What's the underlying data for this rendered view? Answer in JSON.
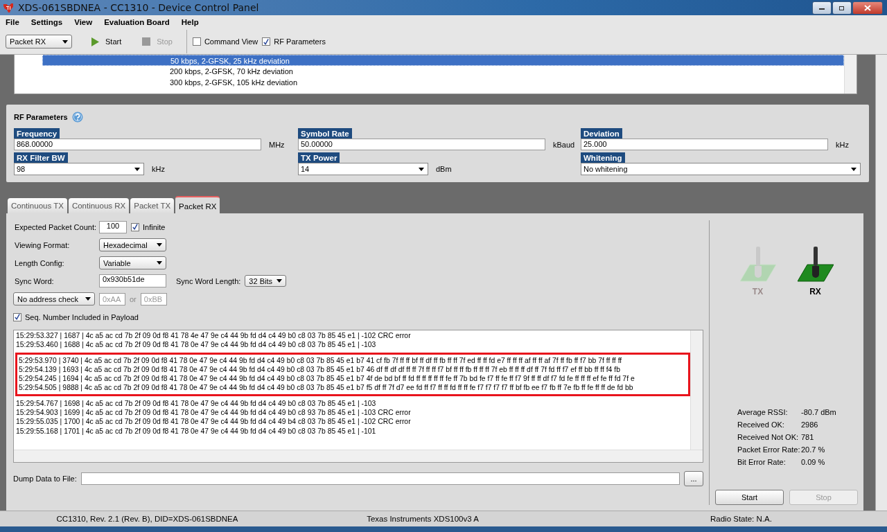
{
  "window": {
    "title": "XDS-061SBDNEA - CC1310 - Device Control Panel"
  },
  "menu": [
    {
      "label": "File"
    },
    {
      "label": "Settings"
    },
    {
      "label": "View"
    },
    {
      "label": "Evaluation Board"
    },
    {
      "label": "Help"
    }
  ],
  "toolbar": {
    "mode": "Packet RX",
    "start": {
      "label": "Start",
      "disabled": false
    },
    "stop": {
      "label": "Stop",
      "disabled": true
    },
    "checks": [
      {
        "label": "Command View",
        "checked": false
      },
      {
        "label": "RF Parameters",
        "checked": true
      }
    ]
  },
  "presets": [
    {
      "label": "50 kbps, 2-GFSK, 25 kHz deviation",
      "selected": true
    },
    {
      "label": "200 kbps, 2-GFSK, 70 kHz deviation",
      "selected": false
    },
    {
      "label": "300 kbps, 2-GFSK, 105 kHz deviation",
      "selected": false
    }
  ],
  "rf_parameters": {
    "title": "RF Parameters",
    "fields": [
      {
        "label": "Frequency",
        "kind": "input",
        "value": "868.00000",
        "unit": "MHz"
      },
      {
        "label": "Symbol Rate",
        "kind": "input",
        "value": "50.00000",
        "unit": "kBaud"
      },
      {
        "label": "Deviation",
        "kind": "input",
        "value": "25.000",
        "unit": "kHz"
      },
      {
        "label": "RX Filter BW",
        "kind": "select",
        "value": "98",
        "unit": "kHz"
      },
      {
        "label": "TX Power",
        "kind": "select",
        "value": "14",
        "unit": "dBm"
      },
      {
        "label": "Whitening",
        "kind": "select",
        "value": "No whitening"
      }
    ]
  },
  "tabs": [
    {
      "label": "Continuous TX",
      "selected": false
    },
    {
      "label": "Continuous RX",
      "selected": false
    },
    {
      "label": "Packet TX",
      "selected": false
    },
    {
      "label": "Packet RX",
      "selected": true
    }
  ],
  "packet_rx": {
    "expected_count": {
      "label": "Expected Packet Count:",
      "value": "100"
    },
    "infinite": {
      "label": "Infinite",
      "checked": true
    },
    "viewing_format": {
      "label": "Viewing Format:",
      "value": "Hexadecimal"
    },
    "length_config": {
      "label": "Length Config:",
      "value": "Variable"
    },
    "sync_word": {
      "label": "Sync Word:",
      "value": "0x930b51de"
    },
    "sync_word_length": {
      "label": "Sync Word Length:",
      "value": "32 Bits"
    },
    "address_check": {
      "value": "No address check"
    },
    "address_1": {
      "placeholder": "0xAA"
    },
    "or": "or",
    "address_2": {
      "placeholder": "0xBB"
    },
    "seq_number": {
      "label": "Seq. Number Included in Payload",
      "checked": true
    }
  },
  "log": {
    "rows": [
      {
        "text": "15:29:53.327 | 1687 | 4c a5 ac cd 7b 2f 09 0d f8 41 78 4e 47 9e c4 44 9b fd d4 c4 49 b0 c8 03 7b 85 45 e1  | -102 CRC error",
        "highlighted": false
      },
      {
        "text": "15:29:53.460 | 1688 | 4c a5 ac cd 7b 2f 09 0d f8 41 78 0e 47 9e c4 44 9b fd d4 c4 49 b0 c8 03 7b 85 45 e1  | -103",
        "highlighted": false
      },
      {
        "text": "5:29:53.970 | 3740 | 4c a5 ac cd 7b 2f 09 0d f8 41 78 0e 47 9e c4 44 9b fd d4 c4 49 b0 c8 03 7b 85 45 e1 b7 41 cf fb 7f ff ff bf ff df ff fb ff ff 7f ed ff ff fd e7 ff ff ff af ff ff af 7f ff fb ff f7 bb 7f ff ff ff",
        "highlighted": true
      },
      {
        "text": "5:29:54.139 | 1693 | 4c a5 ac cd 7b 2f 09 0d f8 41 78 0e 47 9e c4 44 9b fd d4 c4 49 b0 c8 03 7b 85 45 e1 b7 46 df ff df df ff ff 7f ff ff f7 bf ff ff fb ff ff ff 7f eb ff ff ff df ff 7f fd ff f7 ef ff bb ff ff f4 fb",
        "highlighted": true
      },
      {
        "text": "5:29:54.245 | 1694 | 4c a5 ac cd 7b 2f 09 0d f8 41 78 0e 47 9e c4 44 9b fd d4 c4 49 b0 c8 03 7b 85 45 e1 b7 4f de bd bf ff fd ff ff ff ff ff fe ff 7b bd fe f7 ff fe ff f7 9f ff ff df f7 fd fe ff ff ff ef fe ff fd 7f e",
        "highlighted": true
      },
      {
        "text": "5:29:54.505 | 9888 | 4c a5 ac cd 7b 2f 09 0d f8 41 78 0e 47 9e c4 44 9b fd d4 c4 49 b0 c8 03 7b 85 45 e1 b7 f5 df ff 7f d7 ee fd ff f7 ff ff fd ff ff fe f7 f7 f7 f7 ff bf fb ee f7 fb ff 7e fb ff fe ff ff de fd bb",
        "highlighted": true
      },
      {
        "text": "15:29:54.767 | 1698 | 4c a5 ac cd 7b 2f 09 0d f8 41 78 0e 47 9e c4 44 9b fd d4 c4 49 b0 c8 03 7b 85 45 e1  | -103",
        "highlighted": false
      },
      {
        "text": "15:29:54.903 | 1699 | 4c a5 ac cd 7b 2f 09 0d f8 41 78 0e 47 9e c4 44 9b fd d4 c4 49 b0 c8 93 7b 85 45 e1  | -103 CRC error",
        "highlighted": false
      },
      {
        "text": "15:29:55.035 | 1700 | 4c a5 ac cd 7b 2f 09 0d f8 41 78 0e 47 9e c4 44 9b fd d4 c4 49 b4 c8 03 7b 85 45 e1  | -102 CRC error",
        "highlighted": false
      },
      {
        "text": "15:29:55.168 | 1701 | 4c a5 ac cd 7b 2f 09 0d f8 41 78 0e 47 9e c4 44 9b fd d4 c4 49 b0 c8 03 7b 85 45 e1  | -101",
        "highlighted": false
      }
    ]
  },
  "dump": {
    "label": "Dump Data to File:",
    "browse": "..."
  },
  "indicators": [
    {
      "label": "TX",
      "active": false
    },
    {
      "label": "RX",
      "active": true
    }
  ],
  "stats": [
    {
      "label": "Average RSSI:",
      "value": "-80.7 dBm"
    },
    {
      "label": "Received OK:",
      "value": "2986"
    },
    {
      "label": "Received Not OK:",
      "value": "781"
    },
    {
      "label": "Packet Error Rate:",
      "value": "20.7 %"
    },
    {
      "label": "Bit Error Rate:",
      "value": "0.09 %"
    }
  ],
  "buttons": [
    {
      "label": "Start",
      "disabled": false
    },
    {
      "label": "Stop",
      "disabled": true
    }
  ],
  "status_bar": [
    "CC1310, Rev. 2.1 (Rev. B), DID=XDS-061SBDNEA",
    "Texas Instruments XDS100v3 A",
    "Radio State: N.A."
  ]
}
